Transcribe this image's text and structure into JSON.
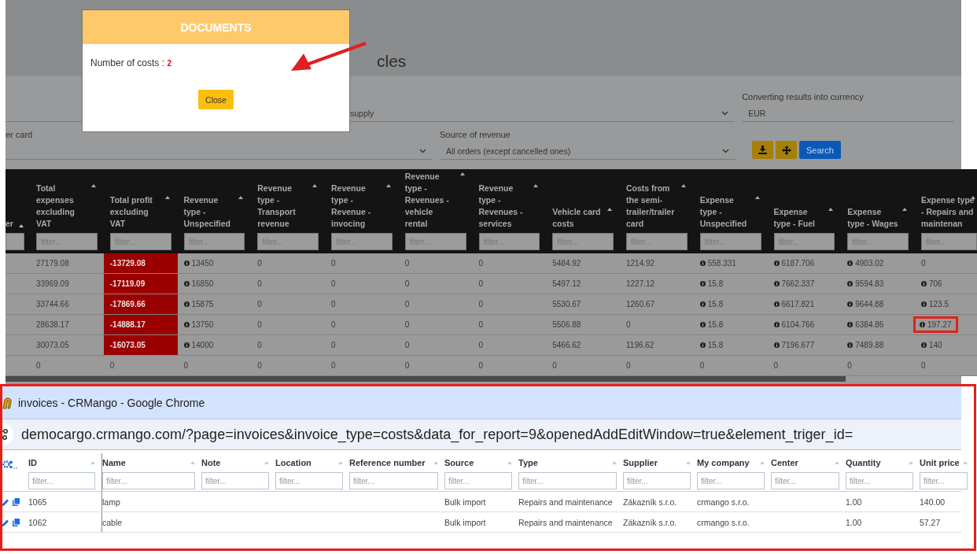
{
  "page": {
    "title_fragment": "cles"
  },
  "filter_rows": [
    [
      {
        "kind": "select",
        "value": "supply"
      },
      {
        "kind": "text",
        "label": "Converting results into currency",
        "value": "EUR"
      }
    ],
    [
      {
        "kind": "select",
        "label": "er card"
      },
      {
        "kind": "select",
        "label": "Source of revenue",
        "value": "All orders (except cancelled ones)"
      }
    ]
  ],
  "filter_buttons": [
    {
      "kind": "download"
    },
    {
      "kind": "move"
    },
    {
      "kind": "search",
      "label": "Search"
    }
  ],
  "table": {
    "columns": [
      {
        "label": "er"
      },
      {
        "label": "Total expenses excluding VAT",
        "placeholder": "filter..."
      },
      {
        "label": "Total profit excluding VAT",
        "placeholder": "filter..."
      },
      {
        "label": "Revenue type - Unspecified",
        "placeholder": "filter..."
      },
      {
        "label": "Revenue type - Transport revenue",
        "placeholder": "filter..."
      },
      {
        "label": "Revenue type - Revenue - invocing",
        "placeholder": "filter..."
      },
      {
        "label": "Revenue type - Revenues - vehicle rental",
        "placeholder": "filter..."
      },
      {
        "label": "Revenue type - Revenues - services",
        "placeholder": "filter..."
      },
      {
        "label": "Vehicle card costs",
        "placeholder": "filter..."
      },
      {
        "label": "Costs from the semi-trailer/trailer card",
        "placeholder": "filter..."
      },
      {
        "label": "Expense type - Unspecified",
        "placeholder": "filter..."
      },
      {
        "label": "Expense type - Fuel",
        "placeholder": "filter..."
      },
      {
        "label": "Expense type - Wages",
        "placeholder": "filter..."
      },
      {
        "label": "Expense type - Repairs and maintenan",
        "placeholder": "filter..."
      }
    ],
    "rows": [
      {
        "cells": [
          null,
          {
            "text": "27179.08",
            "kind": "plain"
          },
          {
            "text": "-13729.08",
            "kind": "loss"
          },
          {
            "text": "13450",
            "kind": "info"
          },
          {
            "text": "0",
            "kind": "plain"
          },
          {
            "text": "0",
            "kind": "plain"
          },
          {
            "text": "0",
            "kind": "plain"
          },
          {
            "text": "0",
            "kind": "plain"
          },
          {
            "text": "5484.92",
            "kind": "plain"
          },
          {
            "text": "1214.92",
            "kind": "plain"
          },
          {
            "text": "558.331",
            "kind": "info"
          },
          {
            "text": "6187.706",
            "kind": "info"
          },
          {
            "text": "4903.02",
            "kind": "info"
          },
          {
            "text": "0",
            "kind": "plain"
          }
        ]
      },
      {
        "cells": [
          null,
          {
            "text": "33969.09",
            "kind": "plain"
          },
          {
            "text": "-17119.09",
            "kind": "loss"
          },
          {
            "text": "16850",
            "kind": "info"
          },
          {
            "text": "0",
            "kind": "plain"
          },
          {
            "text": "0",
            "kind": "plain"
          },
          {
            "text": "0",
            "kind": "plain"
          },
          {
            "text": "0",
            "kind": "plain"
          },
          {
            "text": "5497.12",
            "kind": "plain"
          },
          {
            "text": "1227.12",
            "kind": "plain"
          },
          {
            "text": "15.8",
            "kind": "info"
          },
          {
            "text": "7662.337",
            "kind": "info"
          },
          {
            "text": "9594.83",
            "kind": "info"
          },
          {
            "text": "706",
            "kind": "info"
          }
        ]
      },
      {
        "cells": [
          null,
          {
            "text": "33744.66",
            "kind": "plain"
          },
          {
            "text": "-17869.66",
            "kind": "loss"
          },
          {
            "text": "15875",
            "kind": "info"
          },
          {
            "text": "0",
            "kind": "plain"
          },
          {
            "text": "0",
            "kind": "plain"
          },
          {
            "text": "0",
            "kind": "plain"
          },
          {
            "text": "0",
            "kind": "plain"
          },
          {
            "text": "5530.67",
            "kind": "plain"
          },
          {
            "text": "1260.67",
            "kind": "plain"
          },
          {
            "text": "15.8",
            "kind": "info"
          },
          {
            "text": "6617.821",
            "kind": "info"
          },
          {
            "text": "9644.88",
            "kind": "info"
          },
          {
            "text": "123.5",
            "kind": "info"
          }
        ]
      },
      {
        "cells": [
          null,
          {
            "text": "28638.17",
            "kind": "plain"
          },
          {
            "text": "-14888.17",
            "kind": "loss"
          },
          {
            "text": "13750",
            "kind": "info"
          },
          {
            "text": "0",
            "kind": "plain"
          },
          {
            "text": "0",
            "kind": "plain"
          },
          {
            "text": "0",
            "kind": "plain"
          },
          {
            "text": "0",
            "kind": "plain"
          },
          {
            "text": "5506.88",
            "kind": "plain"
          },
          {
            "text": "0",
            "kind": "plain"
          },
          {
            "text": "15.8",
            "kind": "info"
          },
          {
            "text": "6104.766",
            "kind": "info"
          },
          {
            "text": "6384.86",
            "kind": "info"
          },
          {
            "text": "197.27",
            "kind": "info_boxed"
          }
        ]
      },
      {
        "cells": [
          null,
          {
            "text": "30073.05",
            "kind": "plain"
          },
          {
            "text": "-16073.05",
            "kind": "loss"
          },
          {
            "text": "14000",
            "kind": "info"
          },
          {
            "text": "0",
            "kind": "plain"
          },
          {
            "text": "0",
            "kind": "plain"
          },
          {
            "text": "0",
            "kind": "plain"
          },
          {
            "text": "0",
            "kind": "plain"
          },
          {
            "text": "5466.62",
            "kind": "plain"
          },
          {
            "text": "1196.62",
            "kind": "plain"
          },
          {
            "text": "15.8",
            "kind": "info"
          },
          {
            "text": "7196.677",
            "kind": "info"
          },
          {
            "text": "7489.88",
            "kind": "info"
          },
          {
            "text": "140",
            "kind": "info"
          }
        ]
      },
      {
        "cells": [
          null,
          {
            "text": "0",
            "kind": "plain"
          },
          {
            "text": "0",
            "kind": "plain"
          },
          {
            "text": "0",
            "kind": "plain"
          },
          {
            "text": "0",
            "kind": "plain"
          },
          {
            "text": "0",
            "kind": "plain"
          },
          {
            "text": "0",
            "kind": "plain"
          },
          {
            "text": "0",
            "kind": "plain"
          },
          {
            "text": "0",
            "kind": "plain"
          },
          {
            "text": "0",
            "kind": "plain"
          },
          {
            "text": "0",
            "kind": "plain"
          },
          {
            "text": "0",
            "kind": "plain"
          },
          {
            "text": "0",
            "kind": "plain"
          },
          {
            "text": "0",
            "kind": "plain"
          }
        ]
      }
    ]
  },
  "modal": {
    "title": "DOCUMENTS",
    "label": "Number of costs :",
    "count": "2",
    "button": "Close"
  },
  "popup": {
    "window_title": "invoices - CRMango - Google Chrome",
    "url": "democargo.crmango.com/?page=invoices&invoice_type=costs&data_for_report=9&openedAddEditWindow=true&element_triger_id=",
    "columns": [
      {
        "label": "ID",
        "placeholder": "filter..."
      },
      {
        "label": "Name",
        "placeholder": "filter..."
      },
      {
        "label": "Note",
        "placeholder": "filter..."
      },
      {
        "label": "Location",
        "placeholder": "filter..."
      },
      {
        "label": "Reference number",
        "placeholder": "filter..."
      },
      {
        "label": "Source",
        "placeholder": "filter..."
      },
      {
        "label": "Type",
        "placeholder": "filter..."
      },
      {
        "label": "Supplier",
        "placeholder": "filter..."
      },
      {
        "label": "My company",
        "placeholder": "filter..."
      },
      {
        "label": "Center",
        "placeholder": "filter..."
      },
      {
        "label": "Quantity",
        "placeholder": "filter..."
      },
      {
        "label": "Unit price",
        "placeholder": "filter..."
      }
    ],
    "rows": [
      {
        "cells": [
          "1065",
          "lamp",
          null,
          null,
          null,
          "Bulk import",
          "Repairs and maintenance",
          "Zákazník s.r.o.",
          "crmango s.r.o.",
          null,
          "1.00",
          "140.00"
        ]
      },
      {
        "cells": [
          "1062",
          "cable",
          null,
          null,
          null,
          "Bulk import",
          "Repairs and maintenance",
          "Zákazník s.r.o.",
          "crmango s.r.o.",
          null,
          "1.00",
          "57.27"
        ]
      }
    ]
  }
}
